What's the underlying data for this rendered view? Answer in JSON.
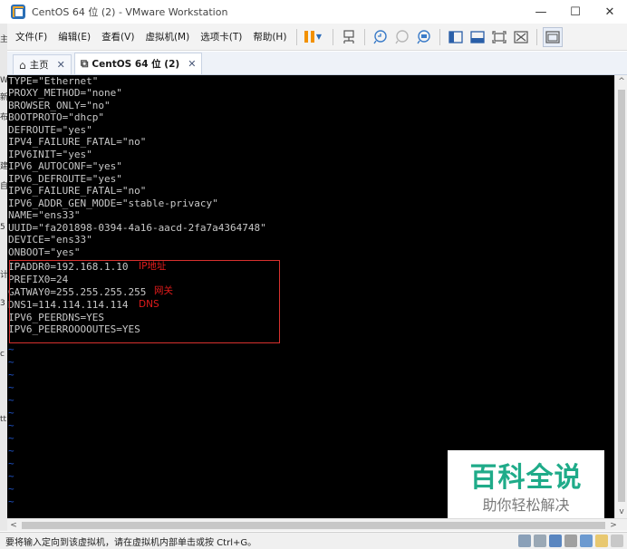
{
  "window": {
    "title": "CentOS 64 位 (2) - VMware Workstation",
    "minimize": "—",
    "maximize": "☐",
    "close": "✕"
  },
  "menu": {
    "items": [
      "文件(F)",
      "编辑(E)",
      "查看(V)",
      "虚拟机(M)",
      "选项卡(T)",
      "帮助(H)"
    ]
  },
  "tabs": [
    {
      "label": "主页",
      "close": "✕"
    },
    {
      "label": "CentOS 64 位 (2)",
      "close": "✕"
    }
  ],
  "console": {
    "lines": [
      "TYPE=\"Ethernet\"",
      "PROXY_METHOD=\"none\"",
      "BROWSER_ONLY=\"no\"",
      "BOOTPROTO=\"dhcp\"",
      "DEFROUTE=\"yes\"",
      "IPV4_FAILURE_FATAL=\"no\"",
      "IPV6INIT=\"yes\"",
      "IPV6_AUTOCONF=\"yes\"",
      "IPV6_DEFROUTE=\"yes\"",
      "IPV6_FAILURE_FATAL=\"no\"",
      "IPV6_ADDR_GEN_MODE=\"stable-privacy\"",
      "NAME=\"ens33\"",
      "UUID=\"fa201898-0394-4a16-aacd-2fa7a4364748\"",
      "DEVICE=\"ens33\"",
      "ONBOOT=\"yes\"",
      "IPADDR0=192.168.1.10",
      "PREFIX0=24",
      "GATWAY0=255.255.255.255",
      "DNS1=114.114.114.114",
      "IPV6_PEERDNS=YES",
      "IPV6_PEERROOOOUTES=YES"
    ],
    "annotations": {
      "ip": "IP地址",
      "gateway": "网关",
      "dns": "DNS"
    },
    "tilde": "~"
  },
  "watermark": {
    "title": "百科全说",
    "subtitle": "助你轻松解决"
  },
  "status": {
    "text": "要将输入定向到该虚拟机，请在虚拟机内部单击或按 Ctrl+G。"
  },
  "left_strip": [
    "主",
    "W",
    "新",
    "布",
    "建",
    "自",
    "5",
    "计",
    "3",
    "c",
    "tt"
  ]
}
